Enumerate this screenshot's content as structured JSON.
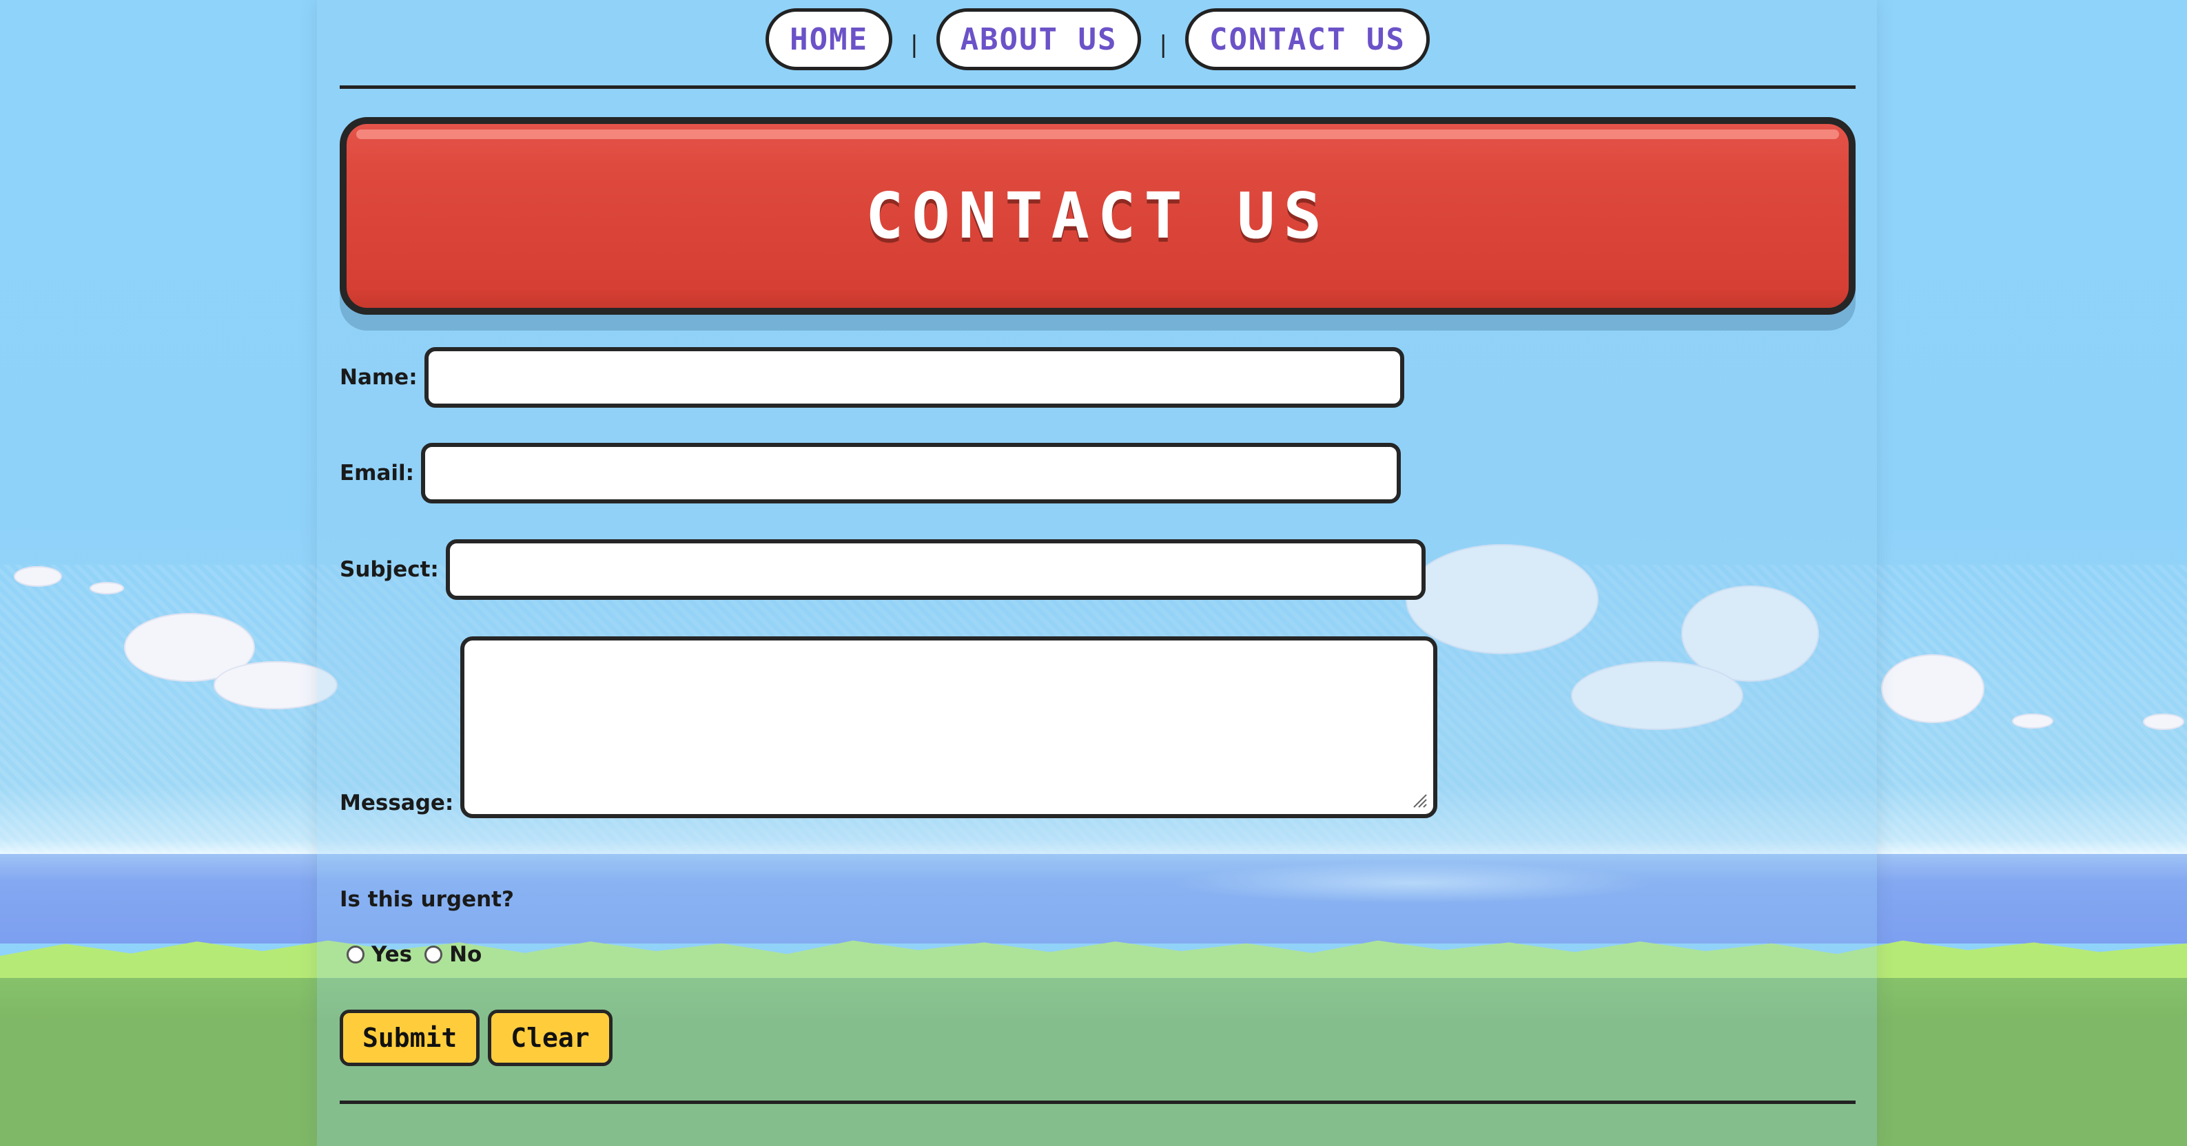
{
  "nav": {
    "items": [
      {
        "label": "HOME"
      },
      {
        "label": "ABOUT US"
      },
      {
        "label": "CONTACT US"
      }
    ],
    "separator": "|"
  },
  "banner": {
    "title": "CONTACT US"
  },
  "form": {
    "name_label": "Name:",
    "email_label": "Email:",
    "subject_label": "Subject:",
    "message_label": "Message:",
    "name_value": "",
    "email_value": "",
    "subject_value": "",
    "message_value": "",
    "urgent_question": "Is this urgent?",
    "urgent_options": [
      {
        "label": "Yes",
        "selected": false
      },
      {
        "label": "No",
        "selected": false
      }
    ],
    "submit_label": "Submit",
    "clear_label": "Clear"
  },
  "colors": {
    "nav_text": "#6b52c8",
    "banner_red": "#d63f33",
    "button_yellow": "#ffcd3c",
    "border_dark": "#262626",
    "sky": "#8fd3fa"
  },
  "icons": {
    "resize_grip": "resize-grip-icon"
  }
}
